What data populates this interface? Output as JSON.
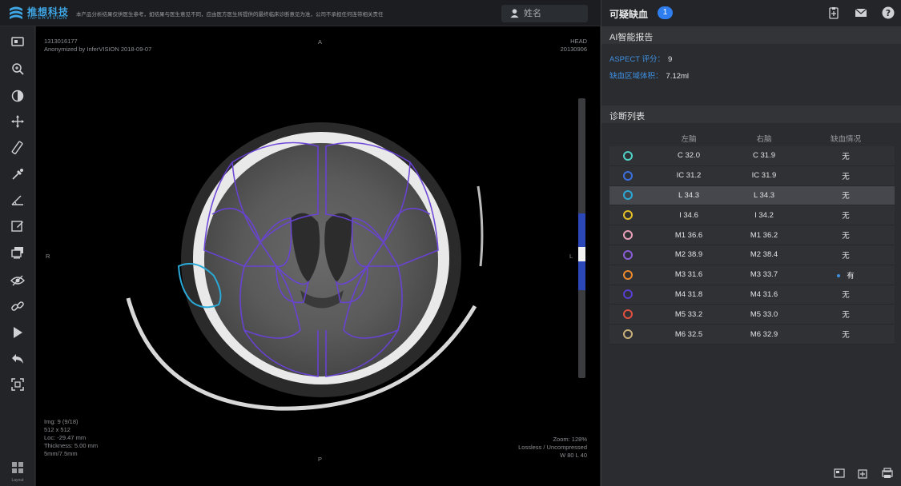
{
  "header": {
    "logo_text": "推想科技",
    "logo_sub": "INFERVISION",
    "disclaimer": "本产品分析结果仅供医生参考，如结果与医生意见不同，应由医方医生所提供的最终临床诊断意见为准，公司不承担任何连带相关责任",
    "name_placeholder": "姓名",
    "colors": {
      "accent": "#3fa7e6"
    }
  },
  "toolbar": {
    "tools": [
      {
        "name": "window-icon"
      },
      {
        "name": "zoom-icon"
      },
      {
        "name": "contrast-icon"
      },
      {
        "name": "pan-icon"
      },
      {
        "name": "ruler-icon"
      },
      {
        "name": "eyedropper-icon"
      },
      {
        "name": "angle-icon"
      },
      {
        "name": "annotate-icon"
      },
      {
        "name": "stack-icon"
      },
      {
        "name": "visibility-icon"
      },
      {
        "name": "link-icon"
      },
      {
        "name": "play-icon"
      },
      {
        "name": "undo-icon"
      },
      {
        "name": "fit-icon"
      }
    ],
    "layout_label": "Layout"
  },
  "viewer": {
    "top_left": [
      "1313016177",
      "Anonymized by InferVISION 2018-09-07"
    ],
    "top_right": [
      "HEAD",
      "20130906"
    ],
    "orientation_top": "A",
    "orientation_bottom": "P",
    "orientation_left": "R",
    "orientation_right": "L",
    "bottom_left": [
      "Img: 9 (9/18)",
      "512 x 512",
      "Loc: -29.47 mm",
      "Thickness: 5.00 mm",
      "5mm/7.5mm"
    ],
    "bottom_right": [
      "Zoom: 128%",
      "Lossless / Uncompressed",
      "W 80 L 40"
    ]
  },
  "panel": {
    "title": "可疑缺血",
    "count": "1",
    "header_icons": [
      "add-report-icon",
      "mail-icon",
      "help-icon"
    ],
    "ai_report": {
      "title": "AI智能报告",
      "aspect_label": "ASPECT 评分：",
      "aspect_value": "9",
      "volume_label": "缺血区域体积：",
      "volume_value": "7.12ml"
    },
    "diagnosis": {
      "title": "诊断列表",
      "columns": [
        "",
        "左脑",
        "右脑",
        "缺血情况"
      ],
      "rows": [
        {
          "color": "#4fd1c5",
          "left": "C 32.0",
          "right": "C 31.9",
          "status": "无",
          "flag": false
        },
        {
          "color": "#3b6fe0",
          "left": "IC 31.2",
          "right": "IC 31.9",
          "status": "无",
          "flag": false
        },
        {
          "color": "#2aa9d8",
          "left": "L 34.3",
          "right": "L 34.3",
          "status": "无",
          "flag": false
        },
        {
          "color": "#e3c028",
          "left": "I 34.6",
          "right": "I 34.2",
          "status": "无",
          "flag": false
        },
        {
          "color": "#e8a0b8",
          "left": "M1 36.6",
          "right": "M1 36.2",
          "status": "无",
          "flag": false
        },
        {
          "color": "#8a5ed8",
          "left": "M2 38.9",
          "right": "M2 38.4",
          "status": "无",
          "flag": false
        },
        {
          "color": "#e88a2e",
          "left": "M3 31.6",
          "right": "M3 33.7",
          "status": "有",
          "flag": true
        },
        {
          "color": "#5a3ed0",
          "left": "M4 31.8",
          "right": "M4 31.6",
          "status": "无",
          "flag": false
        },
        {
          "color": "#e0503e",
          "left": "M5 33.2",
          "right": "M5 33.0",
          "status": "无",
          "flag": false
        },
        {
          "color": "#c8b07a",
          "left": "M6 32.5",
          "right": "M6 32.9",
          "status": "无",
          "flag": false
        }
      ],
      "selected_row": 2
    },
    "footer_icons": [
      "export-icon",
      "add-icon",
      "print-icon"
    ]
  }
}
